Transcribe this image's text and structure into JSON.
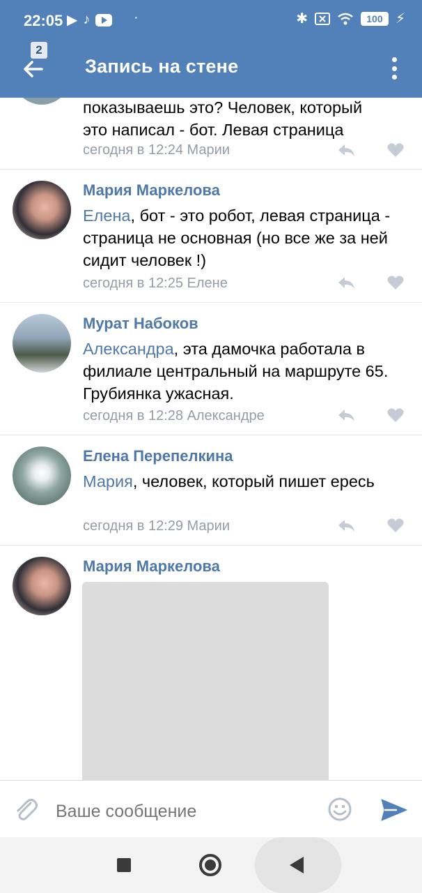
{
  "status_bar": {
    "time": "22:05",
    "battery": "100"
  },
  "header": {
    "title": "Запись на стене",
    "back_badge": "2"
  },
  "comments": [
    {
      "author": "",
      "mention": "",
      "text_lines": [
        "показываешь это? Человек, который",
        "это написал - бот. Левая страница"
      ],
      "meta": "сегодня в 12:24 Марии"
    },
    {
      "author": "Мария Маркелова",
      "mention": "Елена",
      "text": ", бот - это робот, левая страница - страница не основная (но все же за ней сидит человек !)",
      "meta": "сегодня в 12:25 Елене"
    },
    {
      "author": "Мурат Набоков",
      "mention": "Александра",
      "text": ", эта дамочка работала в филиале центральный на маршруте 65. Грубиянка ужасная.",
      "meta": "сегодня в 12:28 Александре"
    },
    {
      "author": "Елена Перепелкина",
      "mention": "Мария",
      "text": ", человек, который пишет ересь",
      "meta": "сегодня в 12:29 Марии"
    },
    {
      "author": "Мария Маркелова",
      "mention": "",
      "text": "",
      "meta": ""
    }
  ],
  "composer": {
    "placeholder": "Ваше сообщение"
  },
  "icons": {
    "back": "arrow-left-icon",
    "menu": "more-vertical-icon",
    "reply": "reply-icon",
    "like": "heart-icon",
    "attach": "paperclip-icon",
    "emoji": "smile-icon",
    "send": "send-icon"
  },
  "colors": {
    "header": "#5181b8",
    "link": "#4f78a8",
    "meta": "#939ca8"
  }
}
